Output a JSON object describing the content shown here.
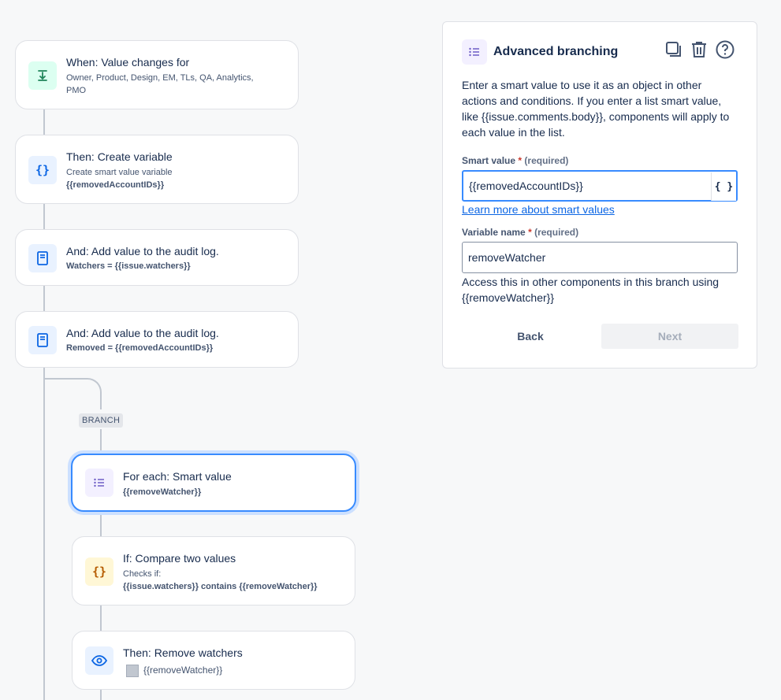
{
  "flow": {
    "trigger": {
      "title": "When: Value changes for",
      "fields_line1": "Owner, Product, Design, EM, TLs, QA, Analytics,",
      "fields_line2": "PMO"
    },
    "create_variable": {
      "title": "Then: Create variable",
      "subtitle": "Create smart value variable",
      "value": "{{removedAccountIDs}}"
    },
    "audit1": {
      "title": "And: Add value to the audit log.",
      "value": "Watchers = {{issue.watchers}}"
    },
    "audit2": {
      "title": "And: Add value to the audit log.",
      "value": "Removed = {{removedAccountIDs}}"
    },
    "branch_label": "BRANCH",
    "for_each": {
      "title": "For each: Smart value",
      "value": "{{removeWatcher}}"
    },
    "compare": {
      "title": "If: Compare two values",
      "subtitle": "Checks if:",
      "value": "{{issue.watchers}} contains {{removeWatcher}}"
    },
    "remove_watchers": {
      "title": "Then: Remove watchers",
      "value": "{{removeWatcher}}"
    }
  },
  "panel": {
    "title": "Advanced branching",
    "description": "Enter a smart value to use it as an object in other actions and conditions. If you enter a list smart value, like {{issue.comments.body}}, components will apply to each value in the list.",
    "smart_value_label": "Smart value",
    "required_star": "*",
    "required_text": "(required)",
    "smart_value": "{{removedAccountIDs}}",
    "brace_button": "{ }",
    "learn_more": "Learn more about smart values",
    "variable_name_label": "Variable name",
    "variable_name": "removeWatcher",
    "helper_line1": "Access this in other components in this branch using",
    "helper_line2": "{{removeWatcher}}",
    "back": "Back",
    "next": "Next"
  }
}
